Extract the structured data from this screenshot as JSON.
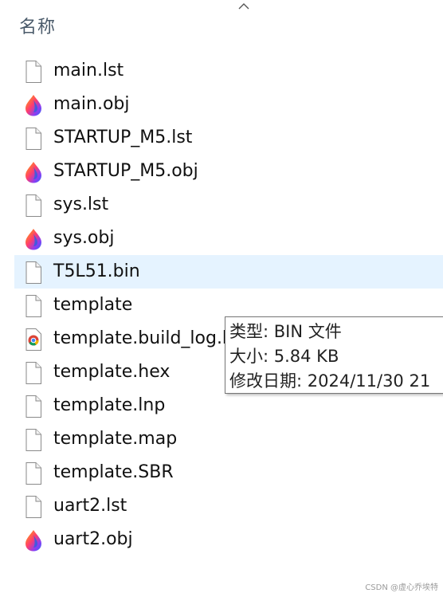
{
  "header": {
    "column_name": "名称",
    "sort_icon": "chevron-up-icon"
  },
  "files": [
    {
      "name": "main.lst",
      "icon": "document-icon"
    },
    {
      "name": "main.obj",
      "icon": "colorful-drop-icon"
    },
    {
      "name": "STARTUP_M5.lst",
      "icon": "document-icon"
    },
    {
      "name": "STARTUP_M5.obj",
      "icon": "colorful-drop-icon"
    },
    {
      "name": "sys.lst",
      "icon": "document-icon"
    },
    {
      "name": "sys.obj",
      "icon": "colorful-drop-icon"
    },
    {
      "name": "T5L51.bin",
      "icon": "document-icon",
      "hovered": true
    },
    {
      "name": "template",
      "icon": "document-icon"
    },
    {
      "name": "template.build_log.htm",
      "icon": "chrome-icon"
    },
    {
      "name": "template.hex",
      "icon": "document-icon"
    },
    {
      "name": "template.lnp",
      "icon": "document-icon"
    },
    {
      "name": "template.map",
      "icon": "document-icon"
    },
    {
      "name": "template.SBR",
      "icon": "document-icon"
    },
    {
      "name": "uart2.lst",
      "icon": "document-icon"
    },
    {
      "name": "uart2.obj",
      "icon": "colorful-drop-icon"
    }
  ],
  "tooltip": {
    "type_line": "类型: BIN 文件",
    "size_line": "大小: 5.84 KB",
    "modified_line": "修改日期: 2024/11/30 21"
  },
  "watermark": "CSDN @虚心乔埃特",
  "colors": {
    "hover_bg": "#e5f3ff",
    "header_text": "#4a5a6a"
  }
}
